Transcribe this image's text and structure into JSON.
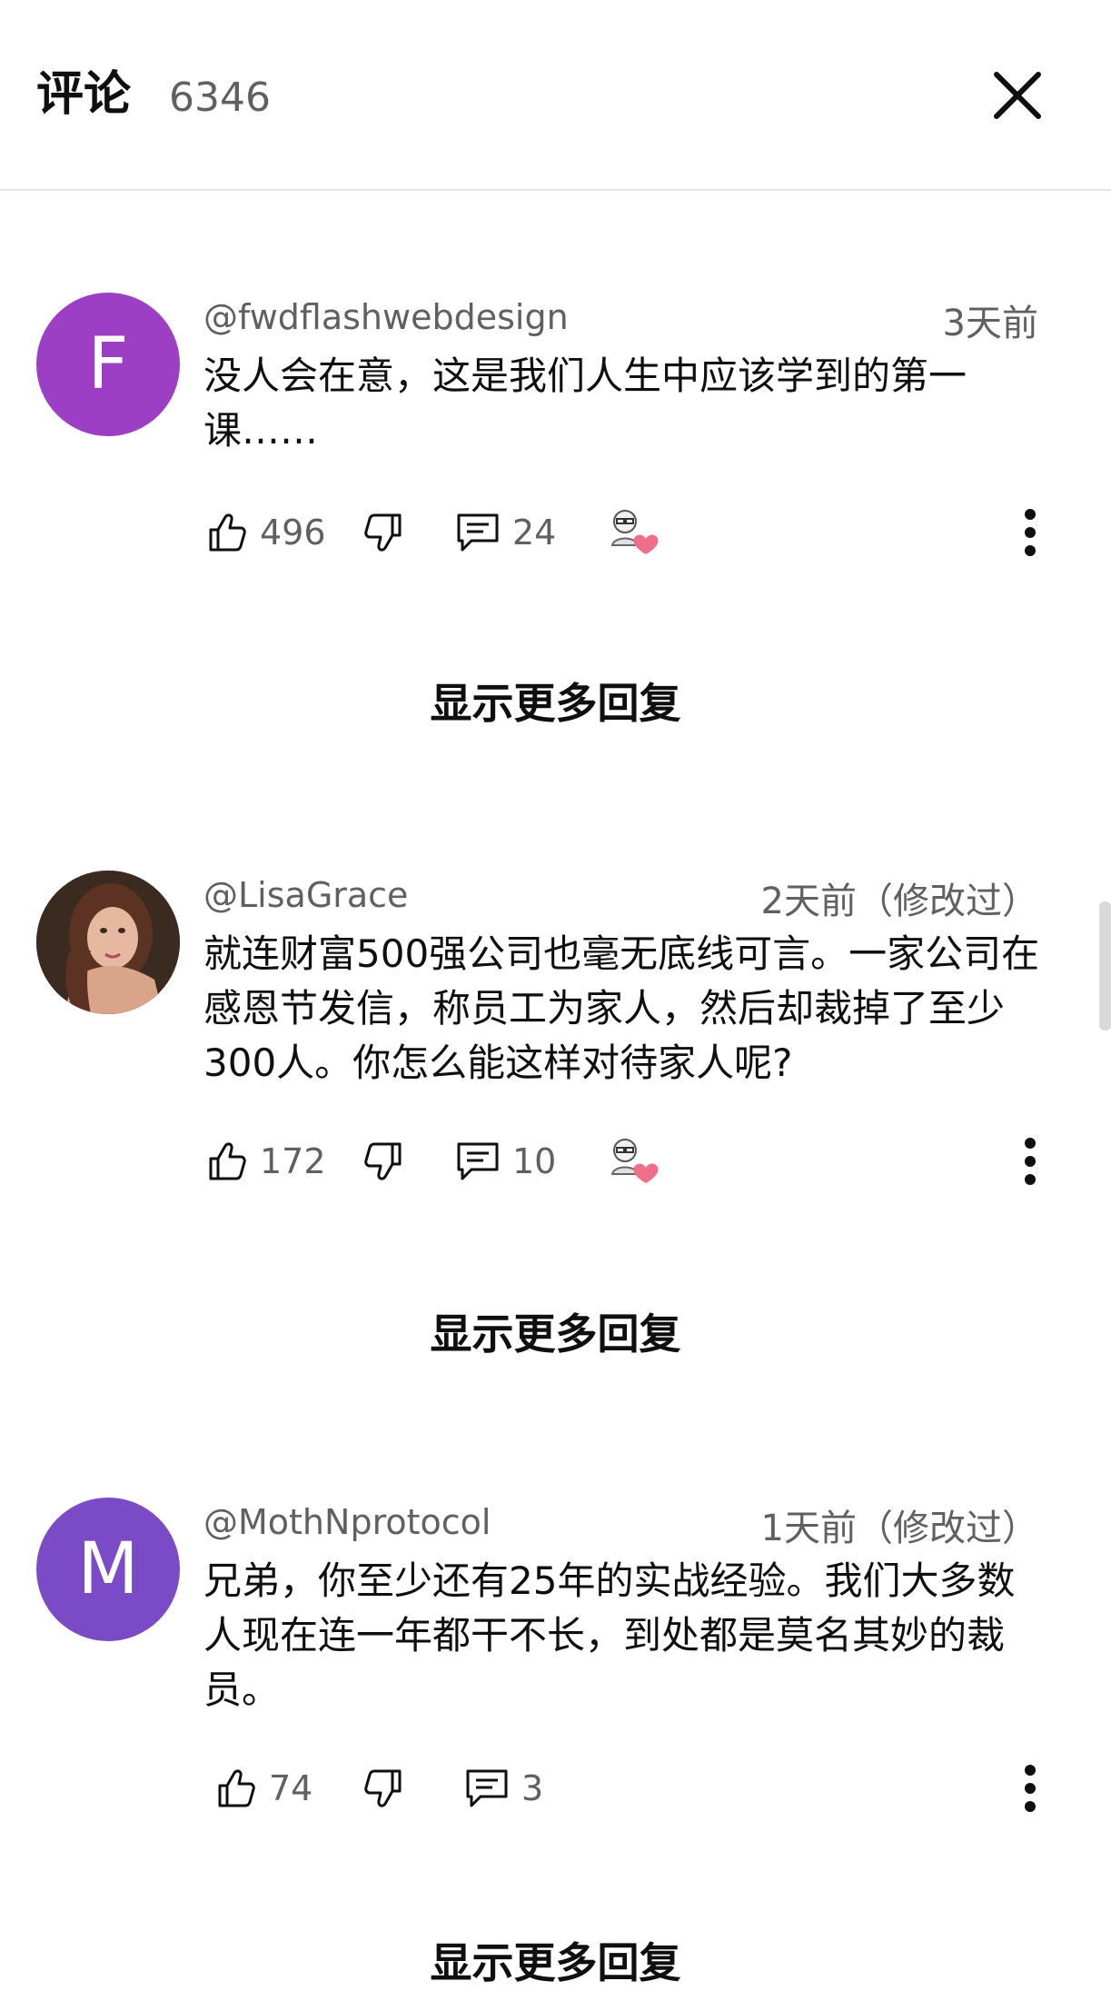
{
  "header": {
    "title": "评论",
    "count": "6346"
  },
  "comments": [
    {
      "avatar_letter": "F",
      "avatar_color": "#9c3fc4",
      "handle": "@fwdflashwebdesign",
      "time": "3天前",
      "text": "没人会在意，这是我们人生中应该学到的第一课……",
      "likes": "496",
      "replies": "24",
      "has_creator_heart": true,
      "show_more_label": "显示更多回复"
    },
    {
      "avatar_letter": "",
      "avatar_color": "#5a3a2c",
      "handle": "@LisaGrace",
      "time": "2天前（修改过）",
      "text": "就连财富500强公司也毫无底线可言。一家公司在感恩节发信，称员工为家人，然后却裁掉了至少300人。你怎么能这样对待家人呢?",
      "likes": "172",
      "replies": "10",
      "has_creator_heart": true,
      "show_more_label": "显示更多回复"
    },
    {
      "avatar_letter": "M",
      "avatar_color": "#7b4ac6",
      "handle": "@MothNprotocol",
      "time": "1天前（修改过）",
      "text": "兄弟，你至少还有25年的实战经验。我们大多数人现在连一年都干不长，到处都是莫名其妙的裁员。",
      "likes": "74",
      "replies": "3",
      "has_creator_heart": false,
      "show_more_label": "显示更多回复"
    }
  ],
  "colors": {
    "heart": "#f06e8a",
    "secondary_text": "#606060"
  }
}
